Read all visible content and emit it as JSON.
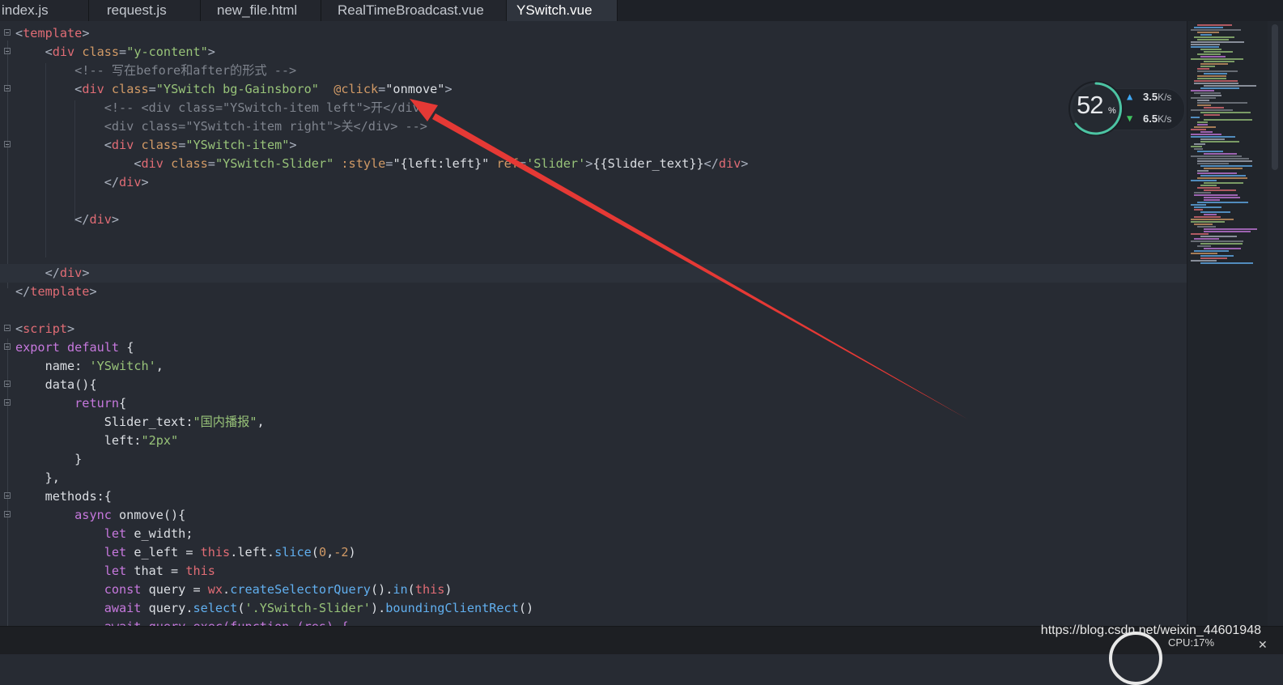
{
  "tabs": [
    {
      "label": "index.js"
    },
    {
      "label": "request.js"
    },
    {
      "label": "new_file.html"
    },
    {
      "label": "RealTimeBroadcast.vue"
    },
    {
      "label": "YSwitch.vue"
    }
  ],
  "code": {
    "l1_tag": "template",
    "l2_tag": "div",
    "l2_attr": "class",
    "l2_val": "\"y-content\"",
    "l3_comment": "<!-- 写在before和after的形式 -->",
    "l4_tag": "div",
    "l4_attr": "class",
    "l4_val": "\"YSwitch bg-Gainsboro\"",
    "l4_attr2": "@click",
    "l4_val2": "\"onmove\"",
    "l5_comment": "<!-- <div class=\"YSwitch-item left\">开</div>",
    "l6_comment": "<div class=\"YSwitch-item right\">关</div> -->",
    "l7_tag": "div",
    "l7_attr": "class",
    "l7_val": "\"YSwitch-item\"",
    "l8_tag": "div",
    "l8_attr": "class",
    "l8_val": "\"YSwitch-Slider\"",
    "l8_attr2": ":style",
    "l8_val2": "\"{left:left}\"",
    "l8_attr3": "ref",
    "l8_val3": "'Slider'",
    "l8_text": "{{Slider_text}}",
    "l9_close": "div",
    "l11_close": "div",
    "l14_close": "div",
    "l15_close": "template",
    "l17_tag": "script",
    "l18_kw1": "export",
    "l18_kw2": "default",
    "l18_rest": " {",
    "l19_key": "name: ",
    "l19_val": "'YSwitch'",
    "l19_end": ",",
    "l20_fn": "data(){",
    "l21_kw": "return",
    "l21_rest": "{",
    "l22_key": "Slider_text:",
    "l22_val": "\"国内播报\"",
    "l22_end": ",",
    "l23_key": "left:",
    "l23_val": "\"2px\"",
    "l24": "}",
    "l25": "},",
    "l26_key": "methods:{",
    "l27_kw": "async",
    "l27_rest": " onmove(){",
    "l28_kw": "let",
    "l28_rest": " e_width;",
    "l29_kw": "let",
    "l29_a": " e_left = ",
    "l29_this": "this",
    "l29_b": ".left.",
    "l29_fn": "slice",
    "l29_c": "(",
    "l29_n1": "0",
    "l29_d": ",",
    "l29_n2": "-2",
    "l29_e": ")",
    "l30_kw": "let",
    "l30_a": " that = ",
    "l30_this": "this",
    "l31_kw": "const",
    "l31_a": " query = ",
    "l31_wx": "wx",
    "l31_b": ".",
    "l31_fn": "createSelectorQuery",
    "l31_c": "().",
    "l31_fn2": "in",
    "l31_d": "(",
    "l31_this": "this",
    "l31_e": ")",
    "l32_kw": "await",
    "l32_a": " query.",
    "l32_fn": "select",
    "l32_b": "(",
    "l32_str": "'.YSwitch-Slider'",
    "l32_c": ").",
    "l32_fn2": "boundingClientRect",
    "l32_d": "()",
    "l33_partial": "await query.exec(function (res) {"
  },
  "net_widget": {
    "percent": "52",
    "percent_sign": "%",
    "upload_value": "3.5",
    "upload_unit": "K/s",
    "download_value": "6.5",
    "download_unit": "K/s"
  },
  "status": {
    "watermark": "https://blog.csdn.net/weixin_44601948",
    "cpu": "CPU:17%"
  },
  "colors": {
    "background": "#272b33",
    "tag": "#e06c75",
    "attribute": "#d19a66",
    "string": "#98c379",
    "comment": "#7f848e",
    "keyword": "#c678dd",
    "function": "#61afef",
    "annotation_arrow": "#e53935"
  }
}
